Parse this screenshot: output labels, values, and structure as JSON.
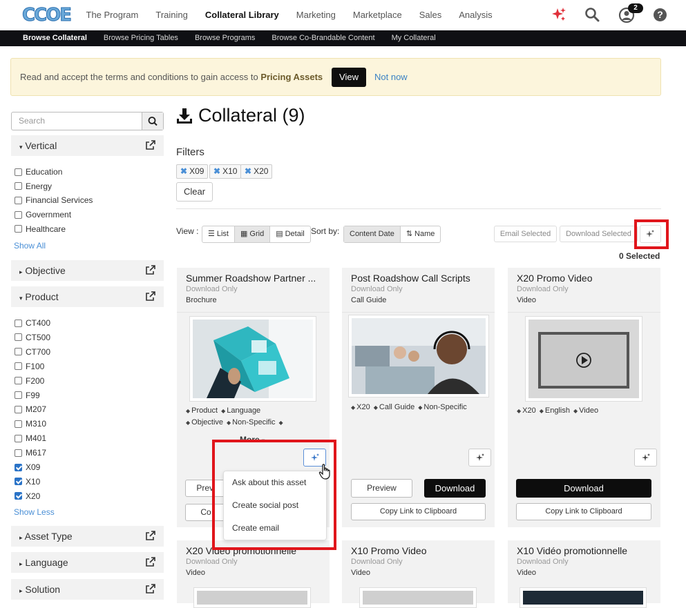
{
  "header": {
    "logo_text": "CCOE",
    "nav": [
      "The Program",
      "Training",
      "Collateral Library",
      "Marketing",
      "Marketplace",
      "Sales",
      "Analysis"
    ],
    "active_nav": "Collateral Library",
    "notification_count": "2",
    "help_glyph": "?"
  },
  "subnav": [
    "Browse Collateral",
    "Browse Pricing Tables",
    "Browse Programs",
    "Browse Co-Brandable Content",
    "My Collateral"
  ],
  "banner": {
    "message": "Read and accept the terms and conditions to gain access to ",
    "message_bold": "Pricing Assets",
    "view_label": "View",
    "not_now_label": "Not now"
  },
  "sidebar": {
    "search_placeholder": "Search",
    "vertical": {
      "label": "Vertical",
      "items": [
        "Education",
        "Energy",
        "Financial Services",
        "Government",
        "Healthcare"
      ],
      "show_label": "Show All"
    },
    "objective": {
      "label": "Objective"
    },
    "product": {
      "label": "Product",
      "items": [
        {
          "label": "CT400",
          "checked": false
        },
        {
          "label": "CT500",
          "checked": false
        },
        {
          "label": "CT700",
          "checked": false
        },
        {
          "label": "F100",
          "checked": false
        },
        {
          "label": "F200",
          "checked": false
        },
        {
          "label": "F99",
          "checked": false
        },
        {
          "label": "M207",
          "checked": false
        },
        {
          "label": "M310",
          "checked": false
        },
        {
          "label": "M401",
          "checked": false
        },
        {
          "label": "M617",
          "checked": false
        },
        {
          "label": "X09",
          "checked": true
        },
        {
          "label": "X10",
          "checked": true
        },
        {
          "label": "X20",
          "checked": true
        }
      ],
      "show_label": "Show Less"
    },
    "asset_type": {
      "label": "Asset Type"
    },
    "language": {
      "label": "Language"
    },
    "solution": {
      "label": "Solution"
    }
  },
  "main": {
    "title": "Collateral (9)",
    "filters_label": "Filters",
    "chips": [
      "X09",
      "X10",
      "X20"
    ],
    "clear_label": "Clear",
    "view_label": "View :",
    "view_options": [
      "List",
      "Grid",
      "Detail"
    ],
    "sort_label": "Sort by:",
    "sort_options": [
      "Content Date",
      "Name"
    ],
    "email_selected": "Email Selected",
    "download_selected": "Download Selected",
    "selected_count": "0 Selected"
  },
  "cards": [
    {
      "title": "Summer Roadshow Partner ...",
      "access": "Download Only",
      "type": "Brochure",
      "tags": [
        "Product",
        "Language",
        "Objective",
        "Non-Specific",
        ""
      ],
      "more_label": "More",
      "preview_label": "Previ",
      "copy_label": "Co"
    },
    {
      "title": "Post Roadshow Call Scripts",
      "access": "Download Only",
      "type": "Call Guide",
      "tags": [
        "X20",
        "Call Guide",
        "Non-Specific"
      ],
      "preview_label": "Preview",
      "download_label": "Download",
      "copy_label": "Copy Link to Clipboard"
    },
    {
      "title": "X20 Promo Video",
      "access": "Download Only",
      "type": "Video",
      "tags": [
        "X20",
        "English",
        "Video"
      ],
      "download_label": "Download",
      "copy_label": "Copy Link to Clipboard"
    },
    {
      "title": "X20 Vidéo promotionnelle",
      "access": "Download Only",
      "type": "Video"
    },
    {
      "title": "X10 Promo Video",
      "access": "Download Only",
      "type": "Video"
    },
    {
      "title": "X10 Vidéo promotionnelle",
      "access": "Download Only",
      "type": "Video"
    }
  ],
  "ai_menu": [
    "Ask about this asset",
    "Create social post",
    "Create email"
  ],
  "colors": {
    "highlight": "#e0151b",
    "accent_link": "#4a8fd6",
    "dark_button": "#0d0d0d",
    "banner_bg": "#fcf5dc"
  }
}
